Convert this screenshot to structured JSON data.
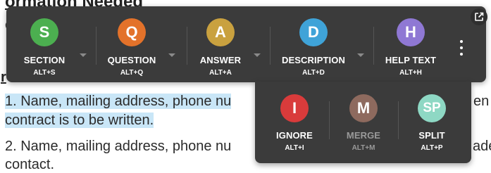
{
  "document": {
    "heading_fragment": "ormation Needed",
    "sub_fragment": "ea",
    "r_fragment": "r",
    "item1_line1": "1.  Name, mailing address, phone nu",
    "item1_line2": "contract is to be written.",
    "item1_tail": "en",
    "item2_line1": "2.  Name, mailing address, phone nu",
    "item2_line2": "contact.",
    "item2_tail": "ade"
  },
  "toolbar": {
    "tools": [
      {
        "letter": "S",
        "label": "SECTION",
        "shortcut": "ALT+S",
        "color": "#4caf50"
      },
      {
        "letter": "Q",
        "label": "QUESTION",
        "shortcut": "ALT+Q",
        "color": "#e3722a"
      },
      {
        "letter": "A",
        "label": "ANSWER",
        "shortcut": "ALT+A",
        "color": "#c9a13f"
      },
      {
        "letter": "D",
        "label": "DESCRIPTION",
        "shortcut": "ALT+D",
        "color": "#3fa3d8"
      },
      {
        "letter": "H",
        "label": "HELP TEXT",
        "shortcut": "ALT+H",
        "color": "#8f78d4"
      }
    ]
  },
  "popover": {
    "tools": [
      {
        "letter": "I",
        "label": "IGNORE",
        "shortcut": "ALT+I",
        "color": "#d93b3b",
        "disabled": false
      },
      {
        "letter": "M",
        "label": "MERGE",
        "shortcut": "ALT+M",
        "color": "#8e6a5e",
        "disabled": true
      },
      {
        "letter": "SP",
        "label": "SPLIT",
        "shortcut": "ALT+P",
        "color": "#8ed8c4",
        "disabled": false
      }
    ]
  },
  "icons": {
    "external": "open-in-new-icon",
    "more": "more-vertical-icon",
    "dropdown": "caret-down-icon"
  },
  "colors": {
    "panel": "#3b3b3b",
    "highlight": "#c9e6f7",
    "disabled_text": "#9a9a9a"
  }
}
